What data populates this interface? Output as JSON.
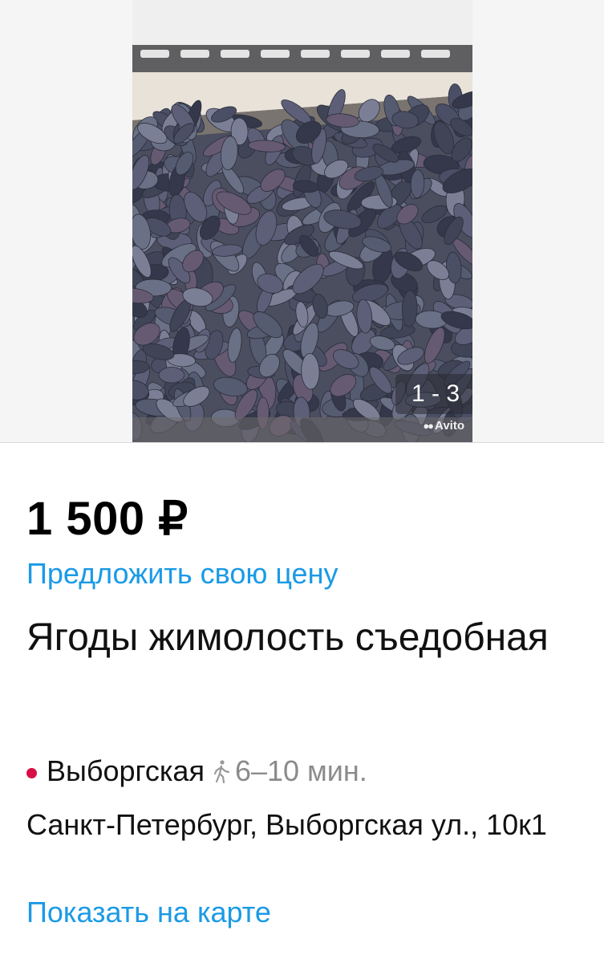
{
  "gallery": {
    "counter": "1 - 3",
    "watermark": "Avito"
  },
  "listing": {
    "price": "1 500 ₽",
    "offer_link": "Предложить свою цену",
    "title": "Ягоды жимолость съедобная",
    "metro_station": "Выборгская",
    "metro_color": "#d80f45",
    "walk_time": "6–10 мин.",
    "address": "Санкт-Петербург, Выборгская ул., 10к1",
    "map_link": "Показать на карте"
  }
}
